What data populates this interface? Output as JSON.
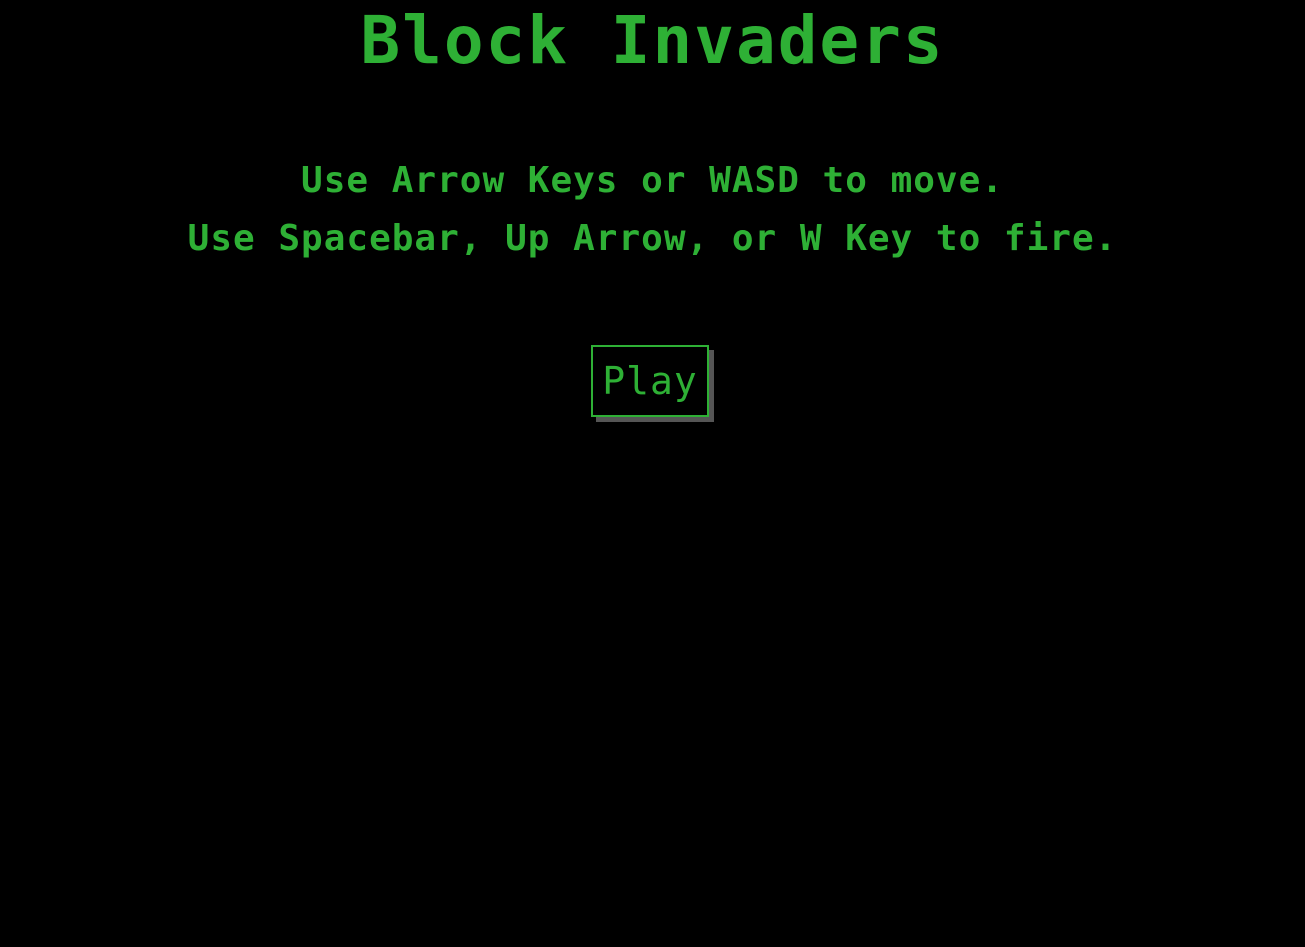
{
  "game": {
    "title": "Block Invaders",
    "accent_color": "#2eb035",
    "background_color": "#000000",
    "shadow_color": "#555555"
  },
  "instructions": {
    "lines": [
      "Use Arrow Keys or WASD to move.",
      "Use Spacebar, Up Arrow, or W Key to fire."
    ]
  },
  "controls": {
    "play_label": "Play"
  }
}
